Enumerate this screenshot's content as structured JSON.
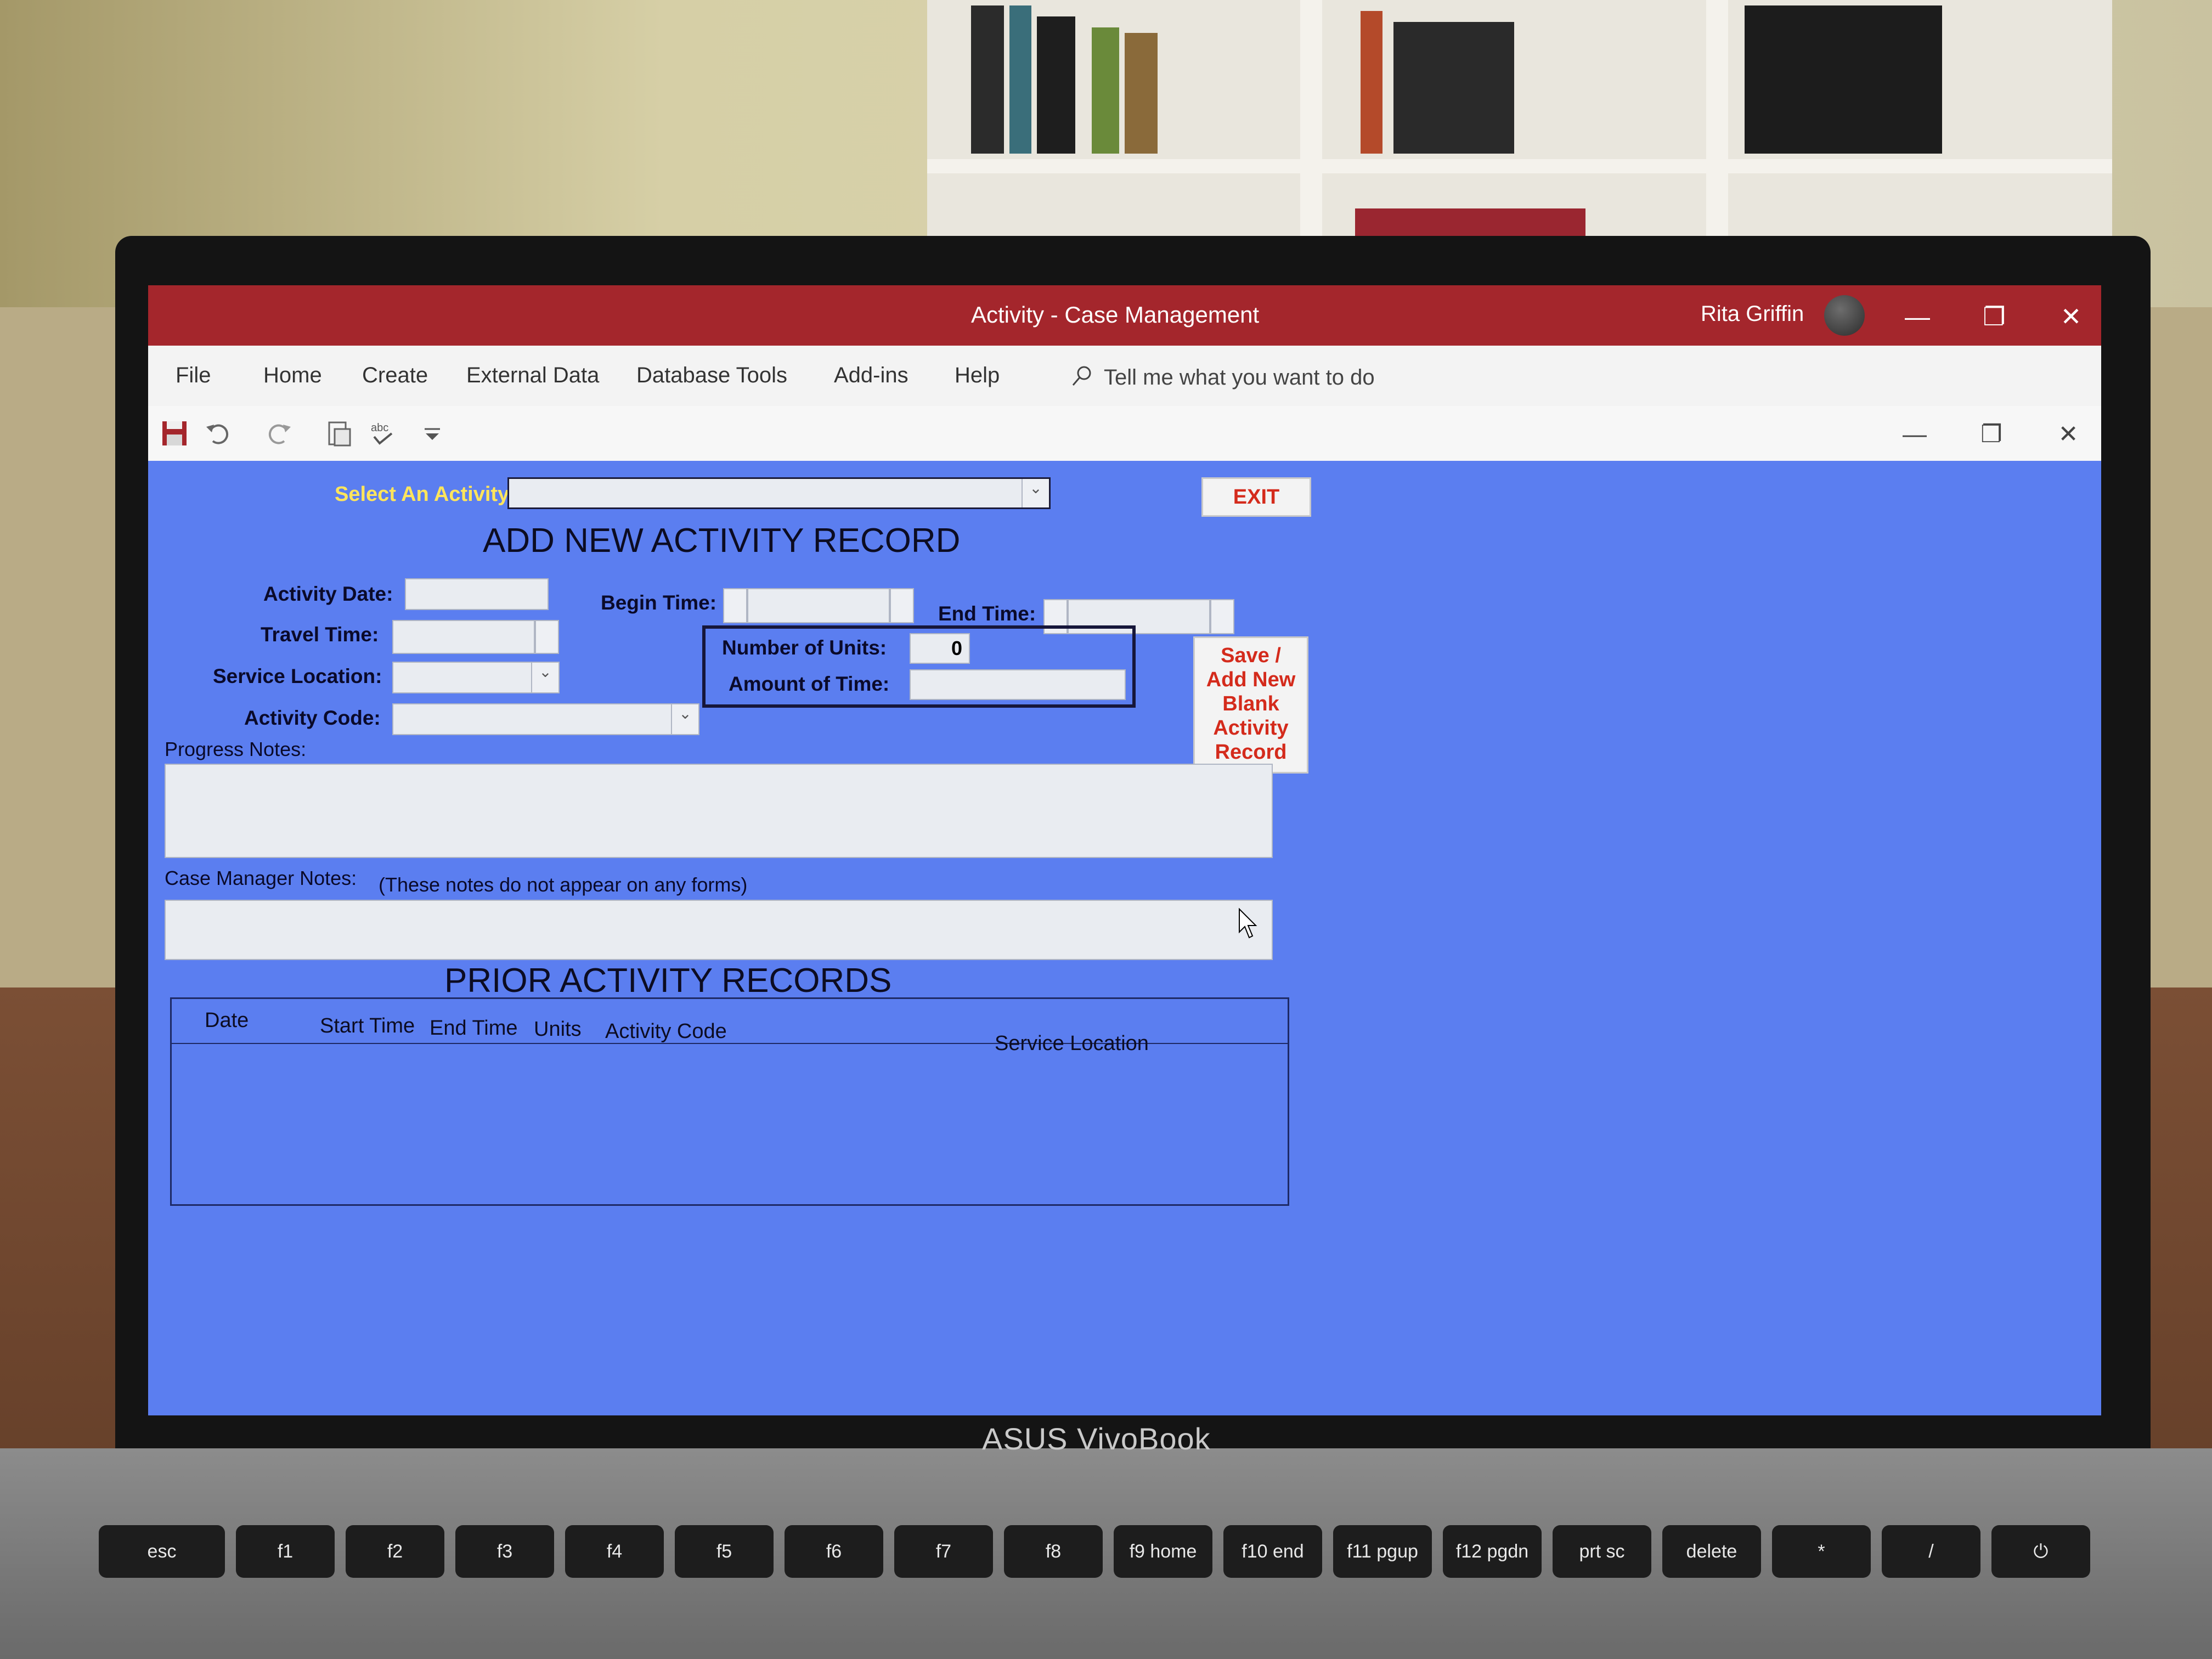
{
  "window": {
    "title": "Activity  -  Case Management",
    "user_name": "Rita Griffin",
    "controls": {
      "minimize": "—",
      "restore": "❐",
      "close": "✕"
    }
  },
  "menu": {
    "items": [
      "File",
      "Home",
      "Create",
      "External Data",
      "Database Tools",
      "Add-ins",
      "Help"
    ],
    "tell_me": "Tell me what you want to do"
  },
  "quick_access": {
    "icons": [
      "save-icon",
      "undo-icon",
      "redo-icon",
      "paste-icon",
      "spelling-icon",
      "customize-icon"
    ],
    "doc_controls": {
      "minimize": "—",
      "restore": "❐",
      "close": "✕"
    }
  },
  "form": {
    "select_activity_label": "Select An Activity",
    "select_activity_value": "",
    "exit_label": "EXIT",
    "heading_new": "ADD NEW ACTIVITY RECORD",
    "activity_date_label": "Activity Date:",
    "travel_time_label": "Travel Time:",
    "service_location_label": "Service Location:",
    "activity_code_label": "Activity Code:",
    "begin_time_label": "Begin Time:",
    "end_time_label": "End Time:",
    "units_label": "Number of Units:",
    "units_value": "0",
    "amount_label": "Amount of Time:",
    "save_button_label": "Save / Add New Blank Activity Record",
    "progress_notes_label": "Progress Notes:",
    "case_manager_notes_label": "Case Manager Notes:",
    "case_manager_notes_hint": "(These notes do not appear on any forms)",
    "heading_prior": "PRIOR ACTIVITY RECORDS",
    "prior_columns": [
      "Date",
      "Start Time",
      "End Time",
      "Units",
      "Activity Code",
      "Service Location"
    ]
  },
  "device": {
    "brand": "ASUS VivoBook",
    "keys": [
      "esc",
      "f1",
      "f2",
      "f3",
      "f4",
      "f5",
      "f6",
      "f7",
      "f8",
      "f9 home",
      "f10 end",
      "f11 pgup",
      "f12 pgdn",
      "prt sc",
      "delete",
      "*",
      "/",
      "⏻"
    ]
  },
  "colors": {
    "title_bar": "#a4262c",
    "form_background": "#5b7ef0",
    "select_label": "#ffe55c",
    "button_text": "#d42b1c"
  }
}
